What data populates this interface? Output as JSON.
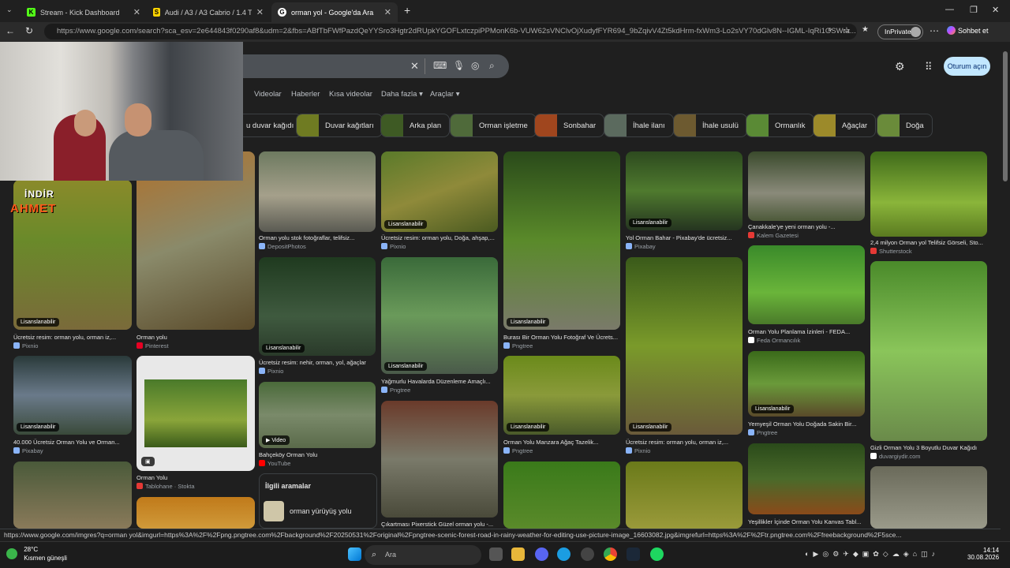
{
  "browser": {
    "tabs": [
      {
        "label": "Stream - Kick Dashboard",
        "fav": "K",
        "favcolor": "#53fc18",
        "active": false
      },
      {
        "label": "Audi / A3 / A3 Cabrio / 1.4 TFSI / A",
        "fav": "S",
        "favcolor": "#ffd400",
        "active": false
      },
      {
        "label": "orman yol - Google'da Ara",
        "fav": "G",
        "favcolor": "#ffffff",
        "active": true
      }
    ],
    "new_tab": "+",
    "url": "https://www.google.com/search?sca_esv=2e644843f0290af8&udm=2&fbs=ABfTbFWfPazdQeYYSro3Hgtr2dRUpkYGOFLxtczpiPPMonK6b-VUW62sVNClvOjXudyfFYR694_9bZqivV4Zt5kdHrm-fxWm3-Lo2sVY70dGlv8N--IGML-IqRi1OSWra...",
    "inprivate": "InPrivate",
    "copilot": "Sohbet et"
  },
  "search": {
    "tabs": [
      "Videolar",
      "Haberler",
      "Kısa videolar",
      "Daha fazla",
      "Araçlar"
    ],
    "signin": "Oturum açın"
  },
  "chips": [
    {
      "label": "u duvar kağıdı",
      "color": "#2f2f2f"
    },
    {
      "label": "Duvar kağıtları",
      "color": "#6f7b22"
    },
    {
      "label": "Arka plan",
      "color": "#3e5a24"
    },
    {
      "label": "Orman işletme",
      "color": "#4f6a3a"
    },
    {
      "label": "Sonbahar",
      "color": "#a0461e"
    },
    {
      "label": "İhale ilanı",
      "color": "#5b6a5e"
    },
    {
      "label": "İhale usulü",
      "color": "#6d5a30"
    },
    {
      "label": "Ormanlık",
      "color": "#5a8a35"
    },
    {
      "label": "Ağaçlar",
      "color": "#9c8a2a"
    },
    {
      "label": "Doğa",
      "color": "#6a8b3a"
    }
  ],
  "results": [
    {
      "caption": "Orman yolu stok fotoğraflar, telifsiz...",
      "source": "DepositPhotos",
      "badge": "",
      "color": "linear-gradient(180deg,#6d7a60,#a5a08b 55%,#5a5a52)"
    },
    {
      "caption": "Ücretsiz resim: orman yolu, Doğa, ahşap,...",
      "source": "Pixnio",
      "badge": "Lisanslanabilir",
      "color": "linear-gradient(160deg,#5a7a2a,#8f8a3a 50%,#4a5a20)"
    },
    {
      "caption": "Yol Orman Bahar - Pixabay'de ücretsiz...",
      "source": "Pixabay",
      "badge": "Lisanslanabilir",
      "color": "linear-gradient(180deg,#2d4a1f,#4f7a2e 50%,#253520)"
    },
    {
      "caption": "Çanakkale'ye yeni orman yolu -...",
      "source": "Kalem Gazetesi",
      "badge": "",
      "color": "linear-gradient(180deg,#3a4a2c,#8a8a7a 60%,#4d5a3a)"
    },
    {
      "caption": "2,4 milyon Orman yol Telifsiz Görseli, Sto...",
      "source": "Shutterstock",
      "badge": "",
      "color": "linear-gradient(180deg,#3f6a1a,#8ab53a 60%,#5a7a20)"
    },
    {
      "caption": "Ücretsiz resim: orman yolu, orman iz,...",
      "source": "Pixnio",
      "badge": "Lisanslanabilir",
      "color": "linear-gradient(180deg,#8a8a2a,#6a8a2a 40%,#7a6a3a)"
    },
    {
      "caption": "Orman yolu",
      "source": "Pinterest",
      "badge": "",
      "color": "linear-gradient(160deg,#b0702a,#8a8a6a 50%,#5a4a2a)"
    },
    {
      "caption": "Ücretsiz resim: nehir, orman, yol, ağaçlar",
      "source": "Pixnio",
      "badge": "Lisanslanabilir",
      "color": "linear-gradient(180deg,#1f3a1f,#3f5a3f 60%,#2a3a2a)"
    },
    {
      "caption": "Yağmurlu Havalarda Düzenleme Amaçlı...",
      "source": "Pngtree",
      "badge": "Lisanslanabilir",
      "color": "linear-gradient(180deg,#3a6a3a,#6a9a5a 50%,#4a5a4a)"
    },
    {
      "caption": "Burası Bir Orman Yolu Fotoğraf Ve Ücrets...",
      "source": "Pngtree",
      "badge": "Lisanslanabilir",
      "color": "linear-gradient(180deg,#2a4a1a,#5a8a2a 50%,#7a7a6a)"
    },
    {
      "caption": "Ücretsiz resim: orman yolu, orman iz,...",
      "source": "Pixnio",
      "badge": "Lisanslanabilir",
      "color": "linear-gradient(180deg,#3a5a1a,#7a9a2a 50%,#6a5a3a)"
    },
    {
      "caption": "Orman Yolu Planlama İzinleri - FEDA...",
      "source": "Feda Ormancılık",
      "badge": "",
      "color": "linear-gradient(180deg,#3a8a2a,#6ab53a 60%,#4a7a2a)"
    },
    {
      "caption": "Gizli Orman Yolu 3 Boyutlu Duvar Kağıdı",
      "source": "duvargiydir.com",
      "badge": "",
      "color": "linear-gradient(180deg,#4a8a2a,#8ac55a 50%,#6a8a4a)"
    },
    {
      "caption": "40.000 Ücretsiz Orman Yolu ve Orman...",
      "source": "Pixabay",
      "badge": "Lisanslanabilir",
      "color": "linear-gradient(180deg,#2a3a3a,#6a7a8a 50%,#3a4a3a)"
    },
    {
      "caption": "Orman Yolu",
      "source": "Tablohane · Stokta",
      "badge": "",
      "color": "linear-gradient(180deg,#e8e8e8,#e0e0e0)"
    },
    {
      "caption": "Bahçeköy Orman Yolu",
      "source": "YouTube",
      "badge": "Video",
      "color": "linear-gradient(180deg,#4a6a3a,#7a8a6a 50%,#5a6a4a)"
    },
    {
      "caption": "Çıkartması Pixerstick Güzel orman yolu -...",
      "source": "",
      "badge": "",
      "color": "linear-gradient(180deg,#6a3a2a,#7a7a6a 50%,#4a4a3a)"
    },
    {
      "caption": "Orman Yolu Manzara Ağaç Tazelik...",
      "source": "Pngtree",
      "badge": "Lisanslanabilir",
      "color": "linear-gradient(180deg,#6a8a1a,#8a9a3a 50%,#4a5a2a)"
    },
    {
      "caption": "Yemyeşil Orman Yolu Doğada Sakin Bir...",
      "source": "Pngtree",
      "badge": "Lisanslanabilir",
      "color": "linear-gradient(180deg,#3a6a1a,#6a9a3a 50%,#5a4a2a)"
    },
    {
      "caption": "Yeşillikler İçinde Orman Yolu Kanvas Tabl...",
      "source": "",
      "badge": "",
      "color": "linear-gradient(180deg,#2a4a1a,#4a6a2a 50%,#8a4a1a)"
    }
  ],
  "related": {
    "title": "İlgili aramalar",
    "item": "orman yürüyüş yolu"
  },
  "overlay": {
    "line1": "İNDİR",
    "line2": "AHMET"
  },
  "status_url": "https://www.google.com/imgres?q=orman yol&imgurl=https%3A%2F%2Fpng.pngtree.com%2Fbackground%2F20250531%2Foriginal%2Fpngtree-scenic-forest-road-in-rainy-weather-for-editing-use-picture-image_16603082.jpg&imgrefurl=https%3A%2F%2Ftr.pngtree.com%2Ffreebackground%2F5sce...",
  "taskbar": {
    "temp": "28°C",
    "weather": "Kısmen güneşli",
    "search_placeholder": "Ara",
    "time": "14:14",
    "date": "30.08.2026"
  }
}
